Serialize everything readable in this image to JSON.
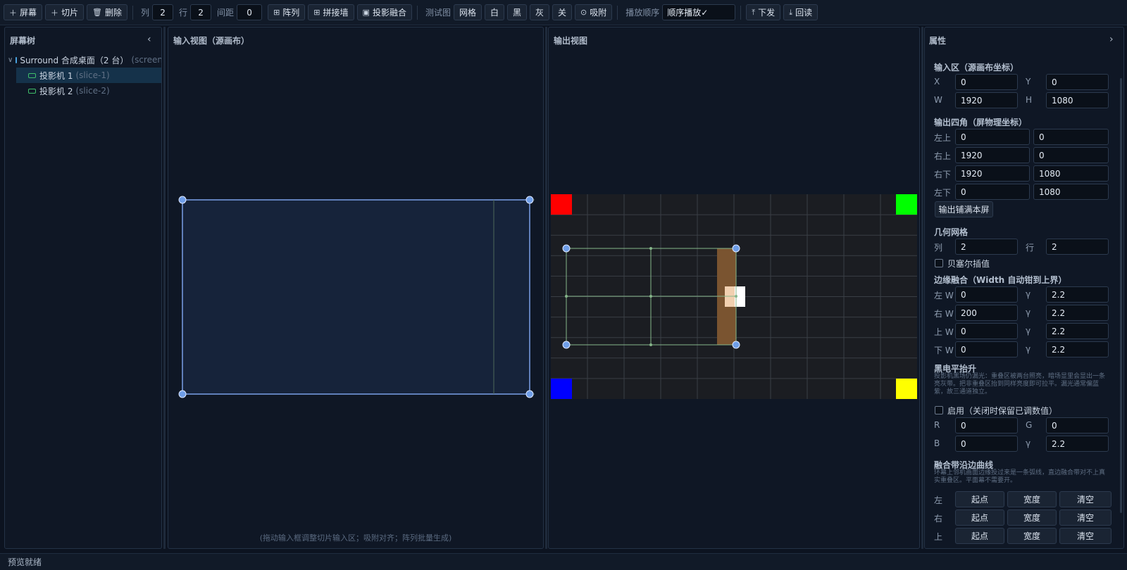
{
  "toolbar": {
    "add_screen": "屏幕",
    "add_slice": "切片",
    "delete": "删除",
    "cols_label": "列",
    "cols_value": "2",
    "rows_label": "行",
    "rows_value": "2",
    "gap_label": "间距",
    "gap_value": "0",
    "array_btn": "阵列",
    "stitch_btn": "拼接墙",
    "blend_btn": "投影融合",
    "test_label": "测试图",
    "test_grid": "网格",
    "test_white": "白",
    "test_black": "黑",
    "test_gray": "灰",
    "test_off": "关",
    "snap_btn": "吸附",
    "order_label": "播放顺序",
    "order_value": "顺序播放✓",
    "push_btn": "下发",
    "readback_btn": "回读"
  },
  "tree": {
    "title": "屏幕树",
    "root_label": "Surround 合成桌面（2 台）",
    "root_id": "(screen",
    "items": [
      {
        "label": "投影机 1",
        "id": "(slice-1)"
      },
      {
        "label": "投影机 2",
        "id": "(slice-2)"
      }
    ]
  },
  "input_view": {
    "title": "输入视图（源画布）",
    "hint": "(拖动输入框调整切片输入区；吸附对齐；阵列批量生成)"
  },
  "output_view": {
    "title": "输出视图",
    "corner_colors": {
      "tl": "#ff0000",
      "tr": "#00ff00",
      "bl": "#0000ff",
      "br": "#ffff00"
    }
  },
  "props": {
    "title": "属性",
    "input_area": {
      "title": "输入区（源画布坐标）",
      "x_label": "X",
      "x": "0",
      "y_label": "Y",
      "y": "0",
      "w_label": "W",
      "w": "1920",
      "h_label": "H",
      "h": "1080"
    },
    "corners": {
      "title": "输出四角（屏物理坐标）",
      "tl_label": "左上",
      "tl_x": "0",
      "tl_y": "0",
      "tr_label": "右上",
      "tr_x": "1920",
      "tr_y": "0",
      "br_label": "右下",
      "br_x": "1920",
      "br_y": "1080",
      "bl_label": "左下",
      "bl_x": "0",
      "bl_y": "1080",
      "fill_btn": "输出铺满本屏"
    },
    "geo_grid": {
      "title": "几何网格",
      "cols_label": "列",
      "cols": "2",
      "rows_label": "行",
      "rows": "2",
      "bezier_label": "贝塞尔插值"
    },
    "edge_blend": {
      "title": "边缘融合（Width 自动钳到上界）",
      "left_label": "左 W",
      "left_w": "0",
      "left_gamma": "2.2",
      "right_label": "右 W",
      "right_w": "200",
      "right_gamma": "2.2",
      "top_label": "上 W",
      "top_w": "0",
      "top_gamma": "2.2",
      "bottom_label": "下 W",
      "bottom_w": "0",
      "bottom_gamma": "2.2",
      "gamma_label": "γ"
    },
    "black_level": {
      "title": "黑电平抬升",
      "note": "投影机黑场仍漏光：重叠区被两台照亮，暗场显里会显出一条亮灰带。把非重叠区抬到同样亮度即可拉平。漏光通常偏蓝紫，故三通道独立。",
      "enable_label": "启用（关闭时保留已调数值）",
      "r_label": "R",
      "r": "0",
      "g_label": "G",
      "g": "0",
      "b_label": "B",
      "b": "0",
      "gamma_label": "γ",
      "gamma": "2.2"
    },
    "curve": {
      "title": "融合带沿边曲线",
      "note": "环幕上邻机画面边缘投过来是一条弧线，直边融合带对不上真实重叠区。平面幕不需要开。",
      "rows": [
        {
          "label": "左",
          "start": "起点",
          "width": "宽度",
          "clear": "清空"
        },
        {
          "label": "右",
          "start": "起点",
          "width": "宽度",
          "clear": "清空"
        },
        {
          "label": "上",
          "start": "起点",
          "width": "宽度",
          "clear": "清空"
        }
      ]
    }
  },
  "status": "预览就绪"
}
